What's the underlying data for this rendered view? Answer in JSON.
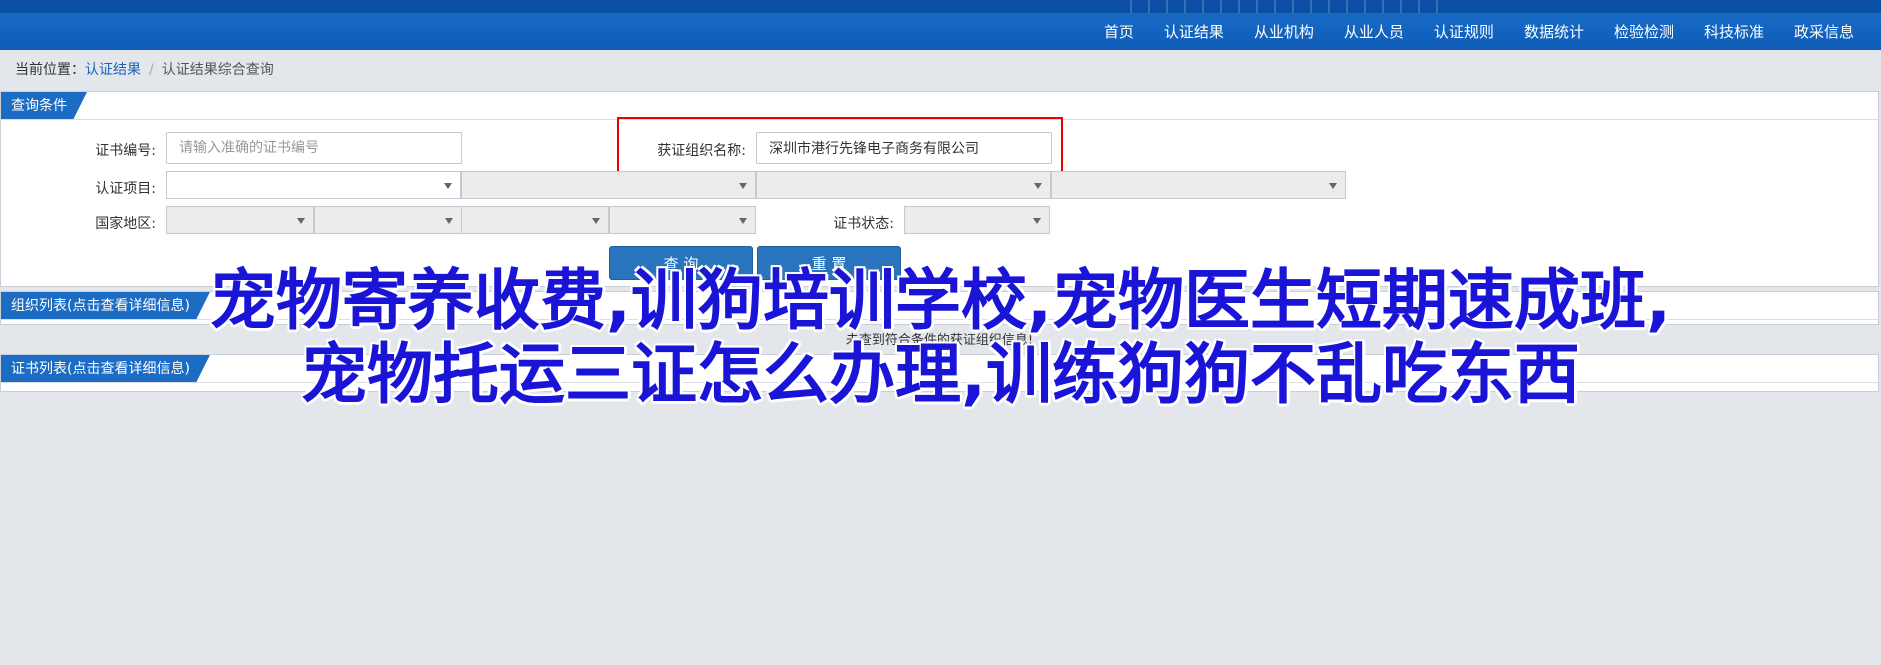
{
  "nav": [
    "首页",
    "认证结果",
    "从业机构",
    "从业人员",
    "认证规则",
    "数据统计",
    "检验检测",
    "科技标准",
    "政采信息"
  ],
  "breadcrumb": {
    "prefix": "当前位置：",
    "link": "认证结果",
    "sep": "/",
    "current": "认证结果综合查询"
  },
  "query_panel": {
    "title": "查询条件",
    "cert_no_label": "证书编号:",
    "cert_no_placeholder": "请输入准确的证书编号",
    "org_name_label": "获证组织名称:",
    "org_name_value": "深圳市港行先锋电子商务有限公司",
    "project_label": "认证项目:",
    "region_label": "国家地区:",
    "status_label": "证书状态:",
    "search_button": "查 询",
    "reset_button": "重 置"
  },
  "org_panel": {
    "title": "组织列表(点击查看详细信息)",
    "empty_message": "未查到符合条件的获证组织信息!"
  },
  "cert_panel": {
    "title": "证书列表(点击查看详细信息)"
  },
  "overlay": {
    "line1": "宠物寄养收费,训狗培训学校,宠物医生短期速成班,",
    "line2": "宠物托运三证怎么办理,训练狗狗不乱吃东西"
  },
  "colors": {
    "nav_bg": "#0e5db8",
    "accent": "#1d6cc4",
    "overlay_text": "#1a14d6",
    "highlight": "#ee0000"
  }
}
